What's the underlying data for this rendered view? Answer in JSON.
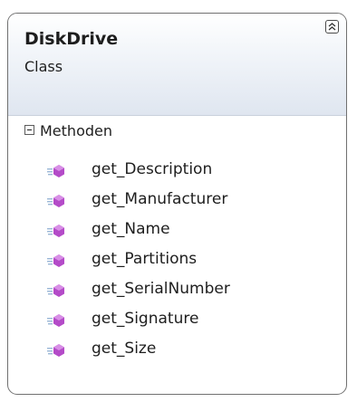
{
  "class_shape": {
    "name": "DiskDrive",
    "kind": "Class",
    "collapse_icon": "chevron-double-up-icon"
  },
  "methods_section": {
    "label": "Methoden",
    "toggle_icon": "minus-box-icon",
    "method_icon": "public-method-icon",
    "items": [
      {
        "label": "get_Description"
      },
      {
        "label": "get_Manufacturer"
      },
      {
        "label": "get_Name"
      },
      {
        "label": "get_Partitions"
      },
      {
        "label": "get_SerialNumber"
      },
      {
        "label": "get_Signature"
      },
      {
        "label": "get_Size"
      }
    ]
  },
  "colors": {
    "border": "#707070",
    "header_gradient_end": "#dfe6f0",
    "method_icon": "#b44bc8"
  }
}
